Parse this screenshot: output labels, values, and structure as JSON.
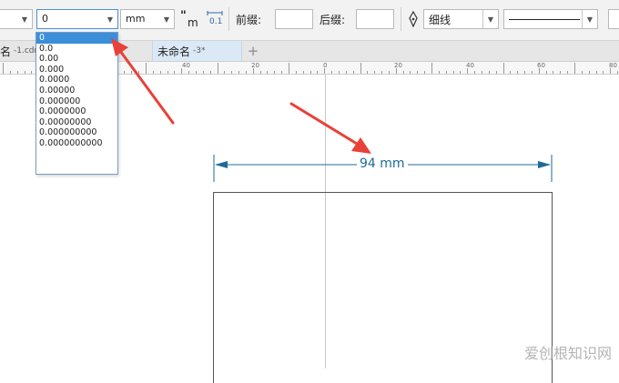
{
  "toolbar": {
    "precision_value": "0",
    "unit_value": "mm",
    "prefix_label": "前缀:",
    "suffix_label": "后缀:",
    "line_style_value": "细线",
    "text_position_icon": "text-position-icon",
    "dynamic_dimension_icon": "dynamic-dimension-icon",
    "dynamic_dimension_text": "0.1",
    "pen_icon": "pen-nib-icon"
  },
  "precision_dropdown": {
    "options": [
      "0",
      "0.0",
      "0.00",
      "0.000",
      "0.0000",
      "0.00000",
      "0.000000",
      "0.0000000",
      "0.00000000",
      "0.000000000",
      "0.0000000000"
    ],
    "selected_index": 0
  },
  "tabs": [
    {
      "name": "名",
      "suffix": "-1.cdr"
    },
    {
      "name": "未命名",
      "suffix": "-3*"
    }
  ],
  "ruler": {
    "labels": [
      "40",
      "20",
      "0",
      "20",
      "40",
      "60",
      "80"
    ]
  },
  "canvas": {
    "dimension_text": "94 mm"
  },
  "watermark": "爱创根知识网",
  "colors": {
    "dimension_line": "#1d6b97",
    "annotation_arrow": "#e8413a",
    "selection": "#3b8fd8"
  }
}
